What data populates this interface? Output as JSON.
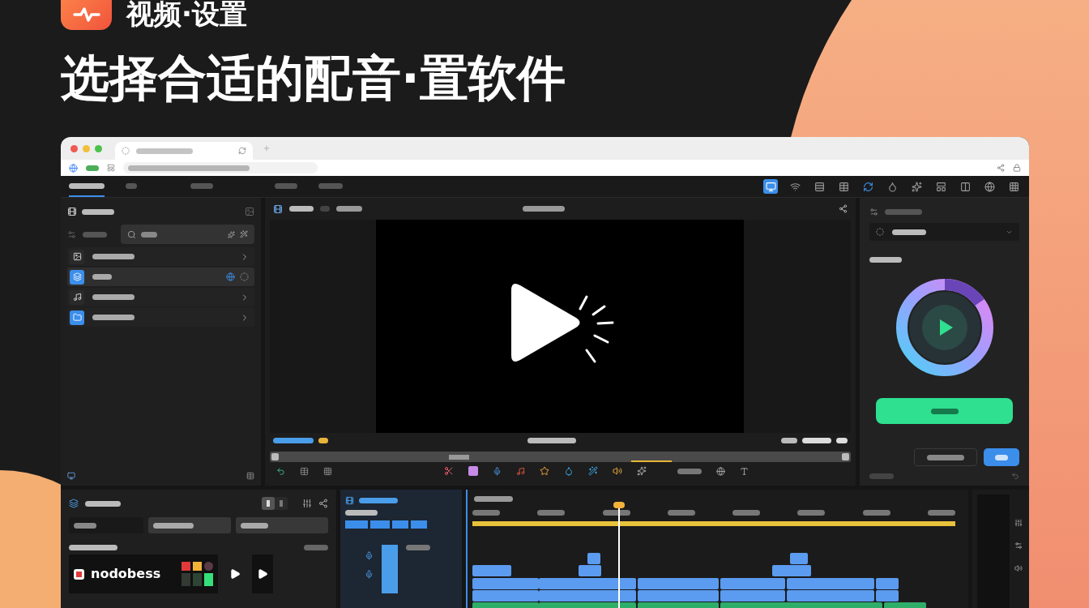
{
  "app": {
    "title": "视频·设置"
  },
  "headline": "选择合适的配音·置软件",
  "toolbar": {
    "tools": [
      {
        "selected": true
      },
      {
        "selected": false
      },
      {
        "selected": false
      },
      {
        "selected": false
      },
      {
        "selected": false
      },
      {
        "selected": false
      },
      {
        "selected": false
      },
      {
        "selected": false
      },
      {
        "selected": false
      },
      {
        "selected": false
      },
      {
        "selected": false
      }
    ]
  },
  "sidebar": {
    "items": [
      {
        "selected": false
      },
      {
        "selected": true
      },
      {
        "selected": false
      },
      {
        "selected": false
      }
    ]
  },
  "menu": {
    "tabs": [
      {
        "selected": true
      },
      {
        "selected": false
      },
      {
        "selected": false
      },
      {
        "selected": false
      },
      {
        "selected": false
      }
    ]
  },
  "view_switch": [
    {
      "selected": true
    },
    {
      "selected": false
    }
  ],
  "preset": {
    "logo_text": "nodobess"
  }
}
